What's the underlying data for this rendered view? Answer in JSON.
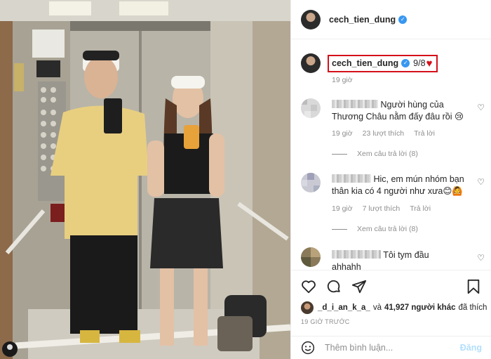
{
  "post": {
    "username": "cech_tien_dung",
    "verified_mark": "✓",
    "caption_text": "9/8",
    "caption_emoji": "♥",
    "caption_time": "19 giờ"
  },
  "comments": [
    {
      "text_line1": "Người hùng của",
      "text_line2": "Thương Châu nằm đấy đâu rồi 😢",
      "time": "19 giờ",
      "likes": "23 lượt thích",
      "reply": "Trả lời",
      "view_replies": "Xem câu trả lời (8)"
    },
    {
      "text_line1": "Hic, em mún nhóm bạn",
      "text_line2": "thân kia có 4 người như xưa😊🙆",
      "time": "19 giờ",
      "likes": "7 lượt thích",
      "reply": "Trả lời",
      "view_replies": "Xem câu trả lời (8)"
    },
    {
      "text_line1": "Tôi tym đầu",
      "text_line2": "ahhahh"
    }
  ],
  "actions": {
    "liked_by_user": "_d_i_an_k_a_",
    "liked_connector": "và",
    "likes_count": "41,927 người khác",
    "likes_suffix": "đã thích",
    "post_time": "19 GIỜ TRƯỚC"
  },
  "add_comment": {
    "placeholder": "Thêm bình luận...",
    "post_label": "Đăng"
  },
  "icons": [
    "heart-icon",
    "comment-icon",
    "share-icon",
    "save-icon",
    "smile-icon"
  ],
  "colors": {
    "highlight_box": "#d4101a",
    "verified": "#3897f0",
    "post_button": "#b2dffc"
  }
}
